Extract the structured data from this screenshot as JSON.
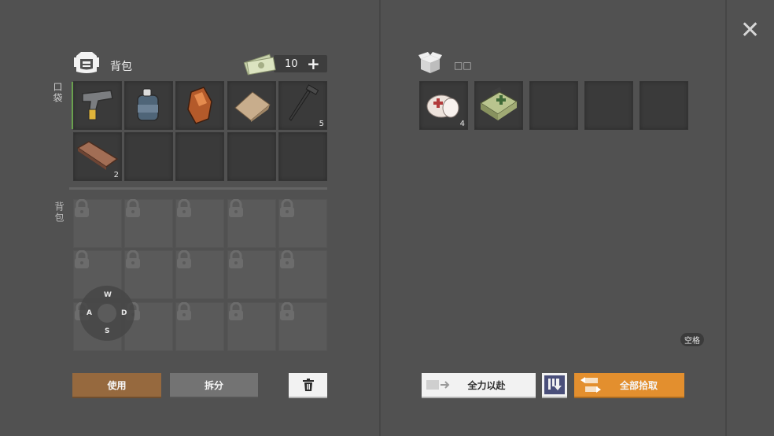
{
  "inventory": {
    "title": "背包",
    "money": "10",
    "add_label": "+",
    "pocket_label": "口袋",
    "backpack_label": "背包",
    "pocket_items": [
      {
        "name": "pistol",
        "count": ""
      },
      {
        "name": "water-canteen",
        "count": ""
      },
      {
        "name": "copper-ore",
        "count": ""
      },
      {
        "name": "cloth",
        "count": ""
      },
      {
        "name": "nail",
        "count": "5"
      },
      {
        "name": "wooden-plank",
        "count": "2"
      }
    ],
    "buttons": {
      "use": "使用",
      "split": "拆分"
    }
  },
  "loot": {
    "title": "□□",
    "items": [
      {
        "name": "bandage-roll",
        "count": "4"
      },
      {
        "name": "first-aid-kit",
        "count": ""
      }
    ],
    "buttons": {
      "take_all_effort": "全力以赴",
      "take_all": "全部拾取"
    },
    "space_hint": "空格"
  },
  "joystick": {
    "up": "W",
    "left": "A",
    "right": "D",
    "down": "S"
  },
  "colors": {
    "use_button": "#96693e",
    "split_button": "#737373",
    "take_all_button": "#e38f2e",
    "pocket_marker": "#69a04e"
  }
}
